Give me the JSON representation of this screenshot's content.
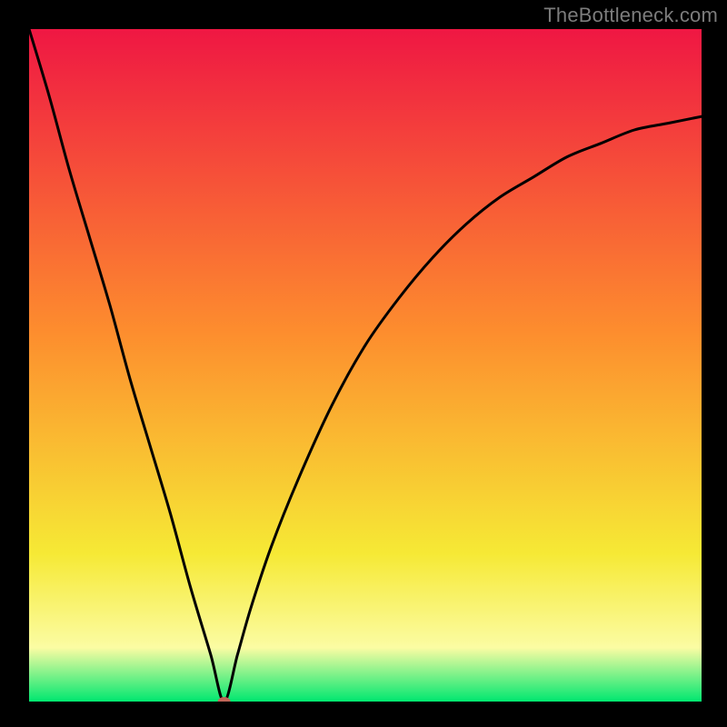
{
  "attribution": "TheBottleneck.com",
  "colors": {
    "gradient_top": "#ef1743",
    "gradient_mid1": "#fd8d2e",
    "gradient_mid2": "#f6e935",
    "gradient_mid3": "#fbfca3",
    "gradient_bottom": "#00e770",
    "curve": "#000000",
    "marker": "#c06558",
    "frame": "#000000",
    "attribution_text": "#7c7c7c"
  },
  "chart_data": {
    "type": "line",
    "title": "",
    "xlabel": "",
    "ylabel": "",
    "xlim": [
      0,
      100
    ],
    "ylim": [
      0,
      100
    ],
    "grid": false,
    "legend": false,
    "annotations": [
      "TheBottleneck.com"
    ],
    "minimum_point": {
      "x": 29,
      "y": 0
    },
    "series": [
      {
        "name": "bottleneck-curve",
        "x": [
          0,
          3,
          6,
          9,
          12,
          15,
          18,
          21,
          24,
          27,
          29,
          31,
          33,
          36,
          40,
          45,
          50,
          55,
          60,
          65,
          70,
          75,
          80,
          85,
          90,
          95,
          100
        ],
        "y": [
          100,
          90,
          79,
          69,
          59,
          48,
          38,
          28,
          17,
          7,
          0,
          7,
          14,
          23,
          33,
          44,
          53,
          60,
          66,
          71,
          75,
          78,
          81,
          83,
          85,
          86,
          87
        ]
      }
    ]
  }
}
